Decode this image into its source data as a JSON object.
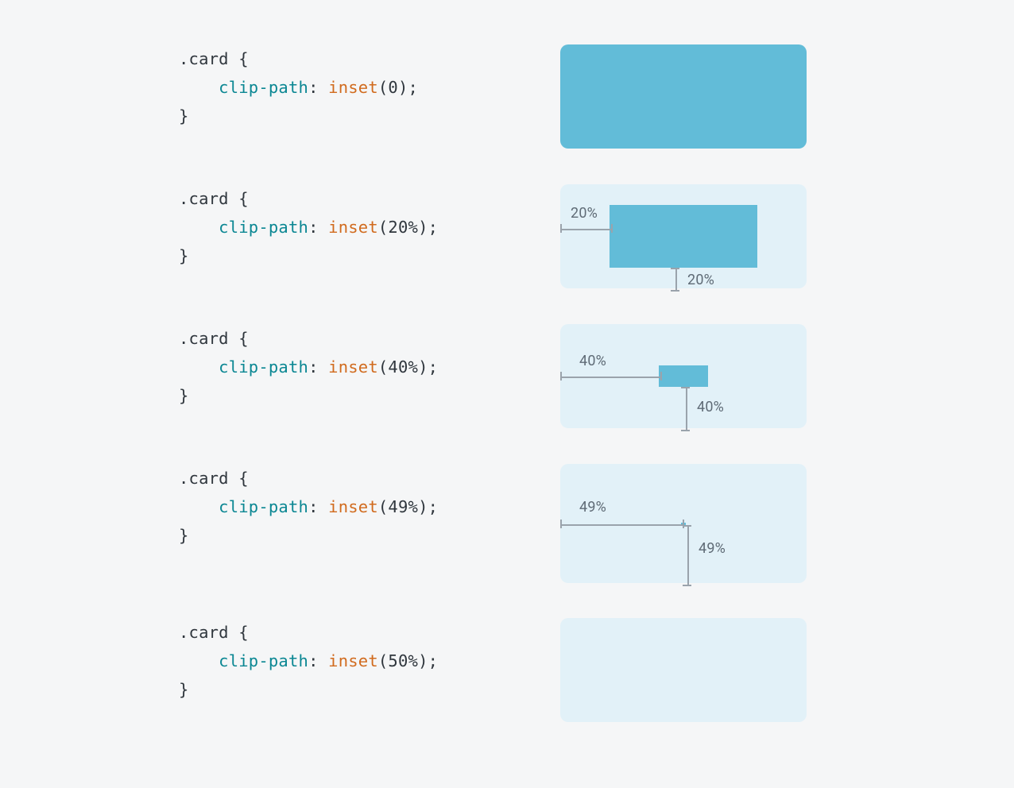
{
  "rows": [
    {
      "selector": ".card",
      "property": "clip-path",
      "func": "inset",
      "arg": "0",
      "label_h": "",
      "label_v": ""
    },
    {
      "selector": ".card",
      "property": "clip-path",
      "func": "inset",
      "arg": "20%",
      "label_h": "20%",
      "label_v": "20%"
    },
    {
      "selector": ".card",
      "property": "clip-path",
      "func": "inset",
      "arg": "40%",
      "label_h": "40%",
      "label_v": "40%"
    },
    {
      "selector": ".card",
      "property": "clip-path",
      "func": "inset",
      "arg": "49%",
      "label_h": "49%",
      "label_v": "49%"
    },
    {
      "selector": ".card",
      "property": "clip-path",
      "func": "inset",
      "arg": "50%",
      "label_h": "",
      "label_v": ""
    }
  ]
}
